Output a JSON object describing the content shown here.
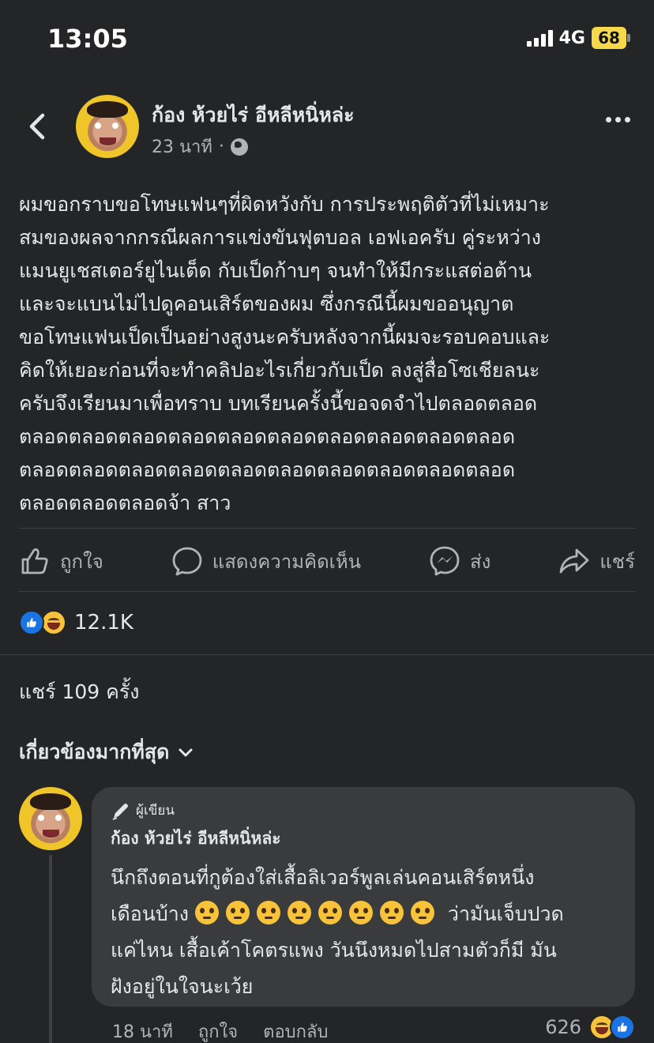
{
  "status_bar": {
    "time": "13:05",
    "network": "4G",
    "battery": "68"
  },
  "post": {
    "author": "ก้อง ห้วยไร่ อีหลีหนิ่หล่ะ",
    "time_ago": "23 นาที",
    "visibility_icon": "globe-icon",
    "body_lines": [
      "ผมขอกราบขอโทษแฟนๆที่ผิดหวังกับ การประพฤติตัวที่ไม่เหมาะ",
      "สมของผลจากกรณีผลการแข่งขันฟุตบอล เอฟเอครับ คู่ระหว่าง",
      "แมนยูเชสเตอร์ยูไนเต็ด กับเป็ดก้าบๆ จนทำให้มีกระแสต่อต้าน",
      "และจะแบนไม่ไปดูคอนเสิร์ตของผม ซึ่งกรณีนี้ผมขออนุญาต",
      "ขอโทษแฟนเป็ดเป็นอย่างสูงนะครับหลังจากนี้ผมจะรอบคอบและ",
      "คิดให้เยอะก่อนที่จะทำคลิปอะไรเกี่ยวกับเป็ด ลงสู่สื่อโซเชียลนะ",
      "ครับจึงเรียนมาเพื่อทราบ บทเรียนครั้งนี้ขอจดจำไปตลอดตลอด",
      "ตลอดตลอดตลอดตลอดตลอดตลอดตลอดตลอดตลอดตลอด",
      "ตลอดตลอดตลอดตลอดตลอดตลอดตลอดตลอดตลอดตลอด",
      "ตลอดตลอดตลอดจ้า สาว"
    ],
    "actions": {
      "like": "ถูกใจ",
      "comment": "แสดงความคิดเห็น",
      "send": "ส่ง",
      "share": "แชร์"
    },
    "reaction_count": "12.1K",
    "shares": "แชร์ 109 ครั้ง",
    "sort_label": "เกี่ยวข้องมากที่สุด"
  },
  "comment": {
    "badge": "ผู้เขียน",
    "author": "ก้อง ห้วยไร่ อีหลีหนิ่หล่ะ",
    "line1": "นึกถึงตอนที่กูต้องใส่เสื้อลิเวอร์พูลเล่นคอนเสิร์ตหนึ่ง",
    "line2_prefix": "เดือนบ้าง",
    "line2_suffix": "ว่ามันเจ็บปวด",
    "line3": "แค่ไหน เสื้อเค้าโคตรแพง วันนึงหมดไปสามตัวก็มี มัน",
    "line4": "ฝังอยู่ในใจนะเว้ย",
    "emoji_names": [
      "crying-face-icon",
      "pleading-face-icon",
      "crying-face-icon",
      "pleading-face-icon",
      "crying-face-icon",
      "pleading-face-icon",
      "pleading-face-icon",
      "pleading-face-icon"
    ],
    "time_ago": "18 นาที",
    "like": "ถูกใจ",
    "reply": "ตอบกลับ",
    "reaction_count": "626"
  },
  "colors": {
    "background": "#242526",
    "bubble": "#3a3b3c",
    "text": "#e4e6eb",
    "muted": "#b0b3b8",
    "like_blue": "#1b74e4",
    "battery": "#f5d94a"
  }
}
